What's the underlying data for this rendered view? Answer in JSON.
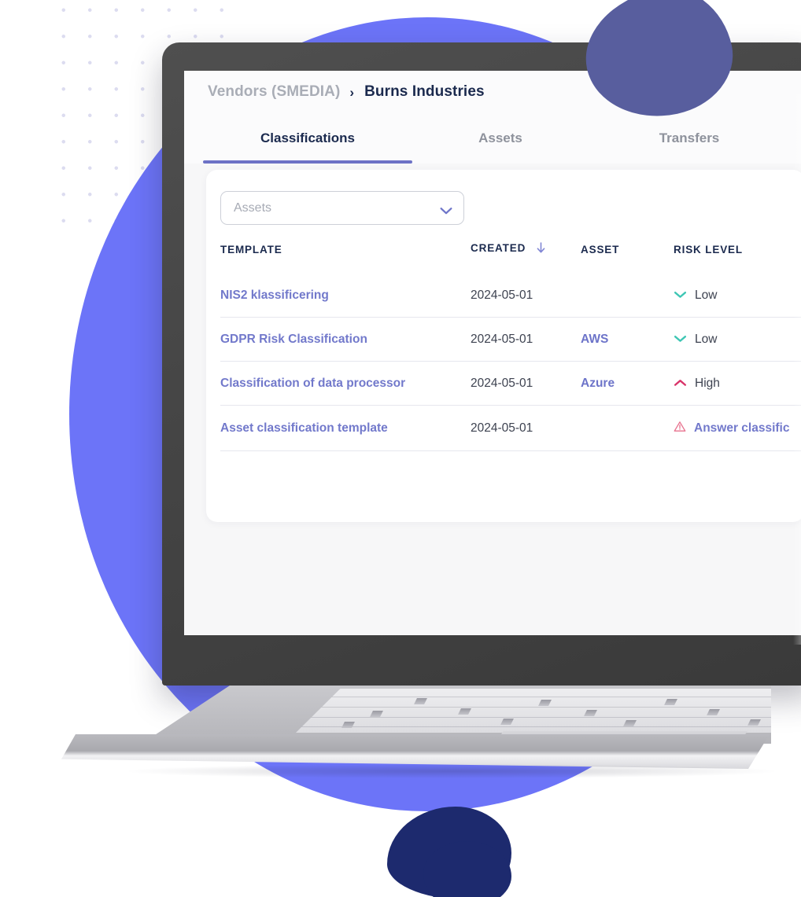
{
  "breadcrumb": {
    "parent": "Vendors (SMEDIA)",
    "separator": "›",
    "current": "Burns Industries"
  },
  "tabs": [
    {
      "label": "Classifications",
      "active": true
    },
    {
      "label": "Assets",
      "active": false
    },
    {
      "label": "Transfers",
      "active": false
    }
  ],
  "filter": {
    "placeholder": "Assets",
    "value": "Assets",
    "icon": "chevron-down-icon"
  },
  "table": {
    "columns": [
      {
        "label": "TEMPLATE",
        "sorted": false
      },
      {
        "label": "CREATED",
        "sorted": true,
        "sort_icon": "arrow-down-icon"
      },
      {
        "label": "ASSET",
        "sorted": false
      },
      {
        "label": "RISK LEVEL",
        "sorted": false
      }
    ],
    "rows": [
      {
        "template": "NIS2 klassificering",
        "created": "2024-05-01",
        "asset": "",
        "risk_label": "Low",
        "risk_icon": "chevron-down-icon",
        "risk_kind": "low"
      },
      {
        "template": "GDPR Risk Classification",
        "created": "2024-05-01",
        "asset": "AWS",
        "risk_label": "Low",
        "risk_icon": "chevron-down-icon",
        "risk_kind": "low"
      },
      {
        "template": "Classification of data processor",
        "created": "2024-05-01",
        "asset": "Azure",
        "risk_label": "High",
        "risk_icon": "chevron-up-icon",
        "risk_kind": "high"
      },
      {
        "template": "Asset classification template",
        "created": "2024-05-01",
        "asset": "",
        "risk_label": "Answer classific",
        "risk_icon": "warning-triangle-icon",
        "risk_kind": "warning"
      }
    ]
  },
  "colors": {
    "accent_purple": "#6d72c6",
    "link_purple": "#7279cb",
    "navy": "#1b2a4e",
    "risk_low_teal": "#3ec6b4",
    "risk_high_red": "#d9356a",
    "warning_pink": "#e8738f",
    "background_periwinkle": "#6c74f8",
    "blob_slate": "#585e9e",
    "blob_navy": "#1d2a6e",
    "screen_bg": "#f7f7f8",
    "bezel": "#464646"
  }
}
